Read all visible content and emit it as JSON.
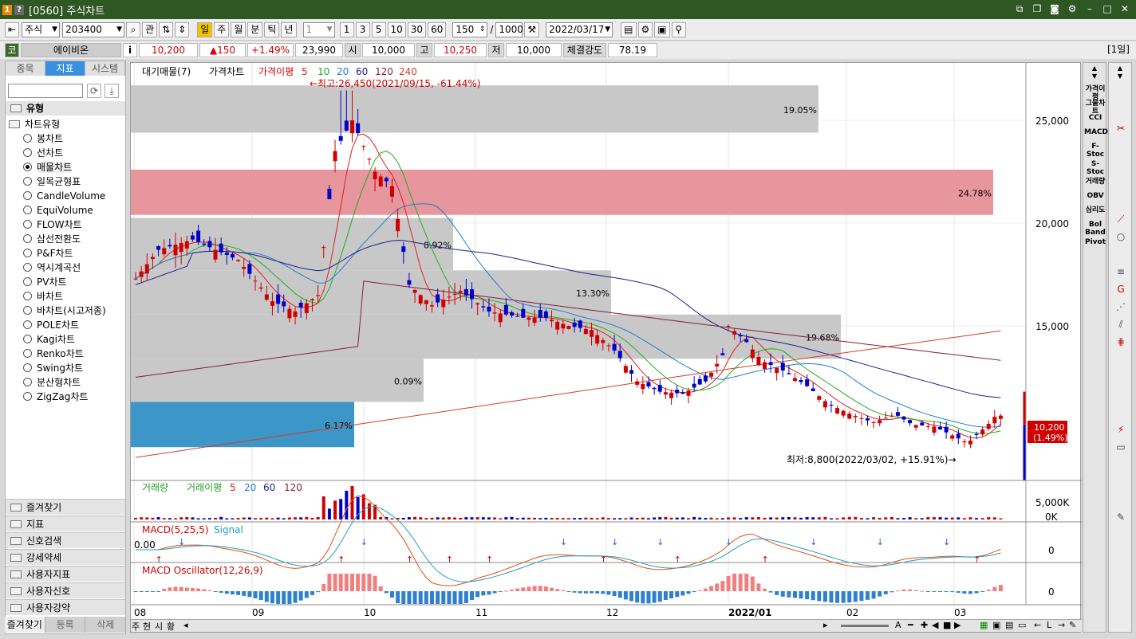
{
  "window": {
    "badge1": "1",
    "badge2": "?",
    "title": "[0560] 주식차트",
    "corner_label": "[1일]"
  },
  "toolbar": {
    "market": "주식",
    "code": "203400",
    "btn_gwan": "관",
    "periods": [
      "일",
      "주",
      "월",
      "분",
      "틱",
      "년"
    ],
    "period_value": "1",
    "intervals": [
      "1",
      "3",
      "5",
      "10",
      "30",
      "60"
    ],
    "count": "150",
    "slash": "/",
    "max_count": "1000",
    "date": "2022/03/17"
  },
  "quote": {
    "prefix": "코",
    "name": "에이비온",
    "info": "i",
    "price": "10,200",
    "change": "▲150",
    "change_pct": "+1.49%",
    "volume": "23,990",
    "open_label": "시",
    "open": "10,000",
    "high_label": "고",
    "high": "10,250",
    "low_label": "저",
    "low": "10,000",
    "strength_label": "체결강도",
    "strength": "78.19"
  },
  "left_panel": {
    "tabs": [
      "종목",
      "지표",
      "시스템"
    ],
    "active_tab": "지표",
    "section": "유형",
    "group": "차트유형",
    "chart_types": [
      "봉차트",
      "선차트",
      "매물차트",
      "일목균형표",
      "CandleVolume",
      "EquiVolume",
      "FLOW차트",
      "삼선전환도",
      "P&F차트",
      "역시계곡선",
      "PV차트",
      "바차트",
      "바차트(시고저종)",
      "POLE차트",
      "Kagi차트",
      "Renko차트",
      "Swing차트",
      "분산형차트",
      "ZigZag차트"
    ],
    "selected": "매물차트",
    "folders": [
      "즐겨찾기",
      "지표",
      "신호검색",
      "강세약세",
      "사용자지표",
      "사용자신호",
      "사용자강약"
    ],
    "bottom_tabs": [
      "즐겨찾기",
      "등록",
      "삭제"
    ]
  },
  "chart": {
    "price_legend": [
      "대기매물(7)",
      "가격차트",
      "가격이평",
      "5",
      "10",
      "20",
      "60",
      "120",
      "240"
    ],
    "high_annotation": "←최고:26,450(2021/09/15, -61.44%)",
    "low_annotation": "최저:8,800(2022/03/02, +15.91%)→",
    "price_ticks": [
      "25,000",
      "20,000",
      "15,000"
    ],
    "current_price": "10,200",
    "current_pct": "(1.49%)",
    "volume_profile": [
      {
        "range": [
          24400,
          26700
        ],
        "pct": "19.05%",
        "color": "#c8c8c8"
      },
      {
        "range": [
          20400,
          22600
        ],
        "pct": "24.78%",
        "color": "#e6969c"
      },
      {
        "range": [
          17700,
          20250
        ],
        "pct": "8.92%",
        "color": "#c8c8c8"
      },
      {
        "range": [
          15550,
          17700
        ],
        "pct": "13.30%",
        "color": "#c8c8c8"
      },
      {
        "range": [
          13400,
          15550
        ],
        "pct": "19.68%",
        "color": "#c8c8c8"
      },
      {
        "range": [
          11300,
          13400
        ],
        "pct": "0.09%",
        "color": "#c8c8c8"
      },
      {
        "range": [
          9100,
          11300
        ],
        "pct": "6.17%",
        "color": "#3c96c8"
      }
    ],
    "volume_legend": [
      "거래량",
      "거래이평",
      "5",
      "20",
      "60",
      "120"
    ],
    "volume_ticks": [
      "5,000K",
      "0K"
    ],
    "macd_legend": [
      "MACD(5,25,5)",
      "Signal"
    ],
    "macd_left_label": "0.00",
    "macd_tick": "0",
    "osc_legend": "MACD Oscillator(12,26,9)",
    "osc_tick": "0",
    "x_labels": [
      "08",
      "09",
      "10",
      "11",
      "12",
      "2022/01",
      "02",
      "03"
    ],
    "colors": {
      "up": "#d00000",
      "down": "#0000c8",
      "ma5": "#e02020",
      "ma10": "#20b020",
      "ma20": "#2080d0",
      "ma60": "#202090",
      "ma120": "#802040",
      "ma240": "#d04030"
    }
  },
  "chart_scroll": {
    "tabs": [
      "주",
      "현",
      "시",
      "황"
    ]
  },
  "right_panel": {
    "items": [
      "가격이평",
      "그물차트",
      "CCI",
      "MACD",
      "F-Stoc",
      "S-Stoc",
      "거래량",
      "OBV",
      "심리도",
      "Bol Band",
      "Pivot"
    ]
  }
}
